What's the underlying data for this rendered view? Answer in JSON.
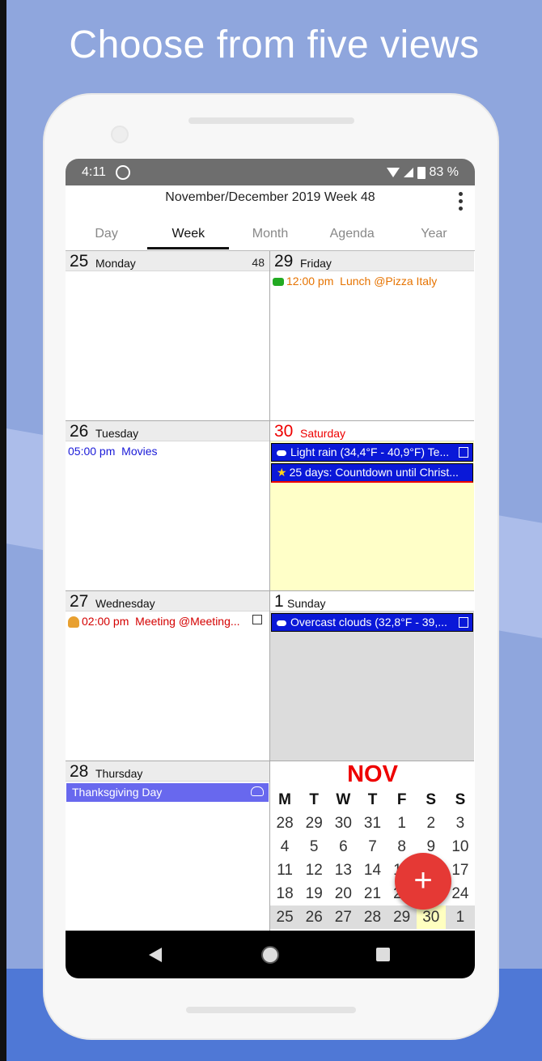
{
  "headline": "Choose from five views",
  "status": {
    "time": "4:11",
    "battery": "83 %"
  },
  "appbar": {
    "title": "November/December 2019 Week 48"
  },
  "tabs": [
    "Day",
    "Week",
    "Month",
    "Agenda",
    "Year"
  ],
  "days": {
    "mon": {
      "num": "25",
      "name": "Monday",
      "week": "48"
    },
    "tue": {
      "num": "26",
      "name": "Tuesday",
      "event_time": "05:00 pm",
      "event_title": "Movies"
    },
    "wed": {
      "num": "27",
      "name": "Wednesday",
      "event_time": "02:00 pm",
      "event_title": "Meeting @Meeting..."
    },
    "thu": {
      "num": "28",
      "name": "Thursday",
      "event_title": "Thanksgiving Day"
    },
    "fri": {
      "num": "29",
      "name": "Friday",
      "event_time": "12:00 pm",
      "event_title": "Lunch @Pizza Italy"
    },
    "sat": {
      "num": "30",
      "name": "Saturday",
      "weather": "Light rain (34,4°F - 40,9°F) Te...",
      "countdown": "25 days: Countdown until Christ..."
    },
    "sun": {
      "num": "1",
      "name": "Sunday",
      "weather": "Overcast clouds (32,8°F - 39,..."
    }
  },
  "mini_calendar": {
    "month": "NOV",
    "weekdays": [
      "M",
      "T",
      "W",
      "T",
      "F",
      "S",
      "S"
    ],
    "weeks": [
      [
        "28",
        "29",
        "30",
        "31",
        "1",
        "2",
        "3"
      ],
      [
        "4",
        "5",
        "6",
        "7",
        "8",
        "9",
        "10"
      ],
      [
        "11",
        "12",
        "13",
        "14",
        "15",
        "16",
        "17"
      ],
      [
        "18",
        "19",
        "20",
        "21",
        "22",
        "23",
        "24"
      ],
      [
        "25",
        "26",
        "27",
        "28",
        "29",
        "30",
        "1"
      ]
    ]
  },
  "fab": "+",
  "colors": {
    "accent_red": "#e53935",
    "event_blue": "#0a18d8",
    "holiday_purple": "#6868ee",
    "today_bg": "#ffffc8"
  }
}
